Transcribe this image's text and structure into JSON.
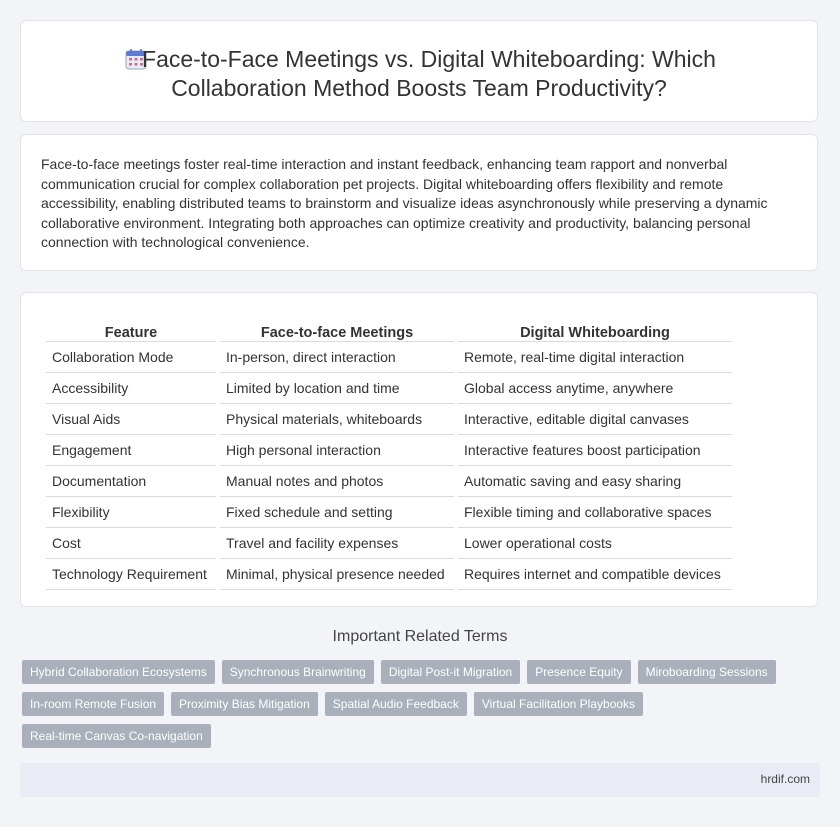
{
  "header": {
    "icon": "calendar-icon",
    "title_line1": "Face-to-Face Meetings vs. Digital Whiteboarding: Which",
    "title_line2": "Collaboration Method Boosts Team Productivity?"
  },
  "intro": "Face-to-face meetings foster real-time interaction and instant feedback, enhancing team rapport and nonverbal communication crucial for complex collaboration pet projects. Digital whiteboarding offers flexibility and remote accessibility, enabling distributed teams to brainstorm and visualize ideas asynchronously while preserving a dynamic collaborative environment. Integrating both approaches can optimize creativity and productivity, balancing personal connection with technological convenience.",
  "table": {
    "headers": [
      "Feature",
      "Face-to-face Meetings",
      "Digital Whiteboarding"
    ],
    "rows": [
      [
        "Collaboration Mode",
        "In-person, direct interaction",
        "Remote, real-time digital interaction"
      ],
      [
        "Accessibility",
        "Limited by location and time",
        "Global access anytime, anywhere"
      ],
      [
        "Visual Aids",
        "Physical materials, whiteboards",
        "Interactive, editable digital canvases"
      ],
      [
        "Engagement",
        "High personal interaction",
        "Interactive features boost participation"
      ],
      [
        "Documentation",
        "Manual notes and photos",
        "Automatic saving and easy sharing"
      ],
      [
        "Flexibility",
        "Fixed schedule and setting",
        "Flexible timing and collaborative spaces"
      ],
      [
        "Cost",
        "Travel and facility expenses",
        "Lower operational costs"
      ],
      [
        "Technology Requirement",
        "Minimal, physical presence needed",
        "Requires internet and compatible devices"
      ]
    ]
  },
  "related": {
    "heading": "Important Related Terms",
    "tags": [
      "Hybrid Collaboration Ecosystems",
      "Synchronous Brainwriting",
      "Digital Post-it Migration",
      "Presence Equity",
      "Miroboarding Sessions",
      "In-room Remote Fusion",
      "Proximity Bias Mitigation",
      "Spatial Audio Feedback",
      "Virtual Facilitation Playbooks",
      "Real-time Canvas Co-navigation"
    ]
  },
  "footer": {
    "site": "hrdif.com"
  }
}
